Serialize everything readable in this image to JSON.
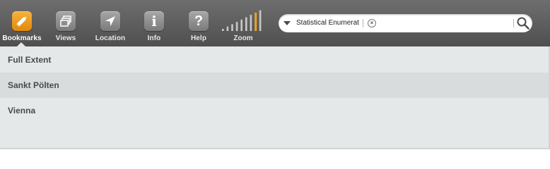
{
  "toolbar": {
    "tools": [
      {
        "label": "Bookmarks",
        "icon": "bookmark-pencil-icon",
        "active": true
      },
      {
        "label": "Views",
        "icon": "views-icon",
        "active": false
      },
      {
        "label": "Location",
        "icon": "location-arrow-icon",
        "active": false
      },
      {
        "label": "Info",
        "icon": "info-icon",
        "active": false
      },
      {
        "label": "Help",
        "icon": "help-icon",
        "active": false
      }
    ],
    "info_glyph": "i",
    "help_glyph": "?",
    "zoom": {
      "label": "Zoom",
      "bar_count": 9,
      "current_level": 7
    }
  },
  "search": {
    "source": "Statistical Enumerat",
    "value": "",
    "placeholder": ""
  },
  "bookmarks": {
    "items": [
      "Full Extent",
      "Sankt Pölten",
      "Vienna"
    ]
  },
  "colors": {
    "toolbar": "#5d5d5d",
    "accent": "#f0a020",
    "panel": "#e4e8e8",
    "row_alt": "#d8dcdc",
    "text": "#4a4a4a"
  }
}
